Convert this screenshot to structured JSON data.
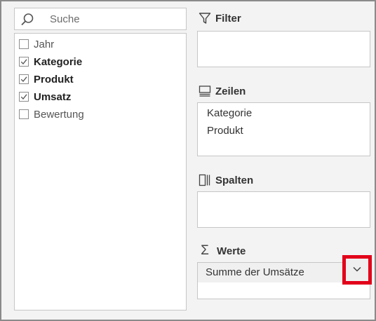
{
  "search": {
    "placeholder": "Suche",
    "icon": "search-icon"
  },
  "fields": [
    {
      "label": "Jahr",
      "checked": false
    },
    {
      "label": "Kategorie",
      "checked": true
    },
    {
      "label": "Produkt",
      "checked": true
    },
    {
      "label": "Umsatz",
      "checked": true
    },
    {
      "label": "Bewertung",
      "checked": false
    }
  ],
  "areas": {
    "filter": {
      "title": "Filter",
      "icon": "filter-icon",
      "items": []
    },
    "rows": {
      "title": "Zeilen",
      "icon": "rows-icon",
      "items": [
        "Kategorie",
        "Produkt"
      ]
    },
    "columns": {
      "title": "Spalten",
      "icon": "columns-icon",
      "items": []
    },
    "values": {
      "title": "Werte",
      "icon": "sigma-icon",
      "items": [
        "Summe der Umsätze"
      ]
    }
  },
  "colors": {
    "highlight": "#e2001a",
    "panel_bg": "#f3f3f3",
    "border": "#8a8a8a"
  }
}
